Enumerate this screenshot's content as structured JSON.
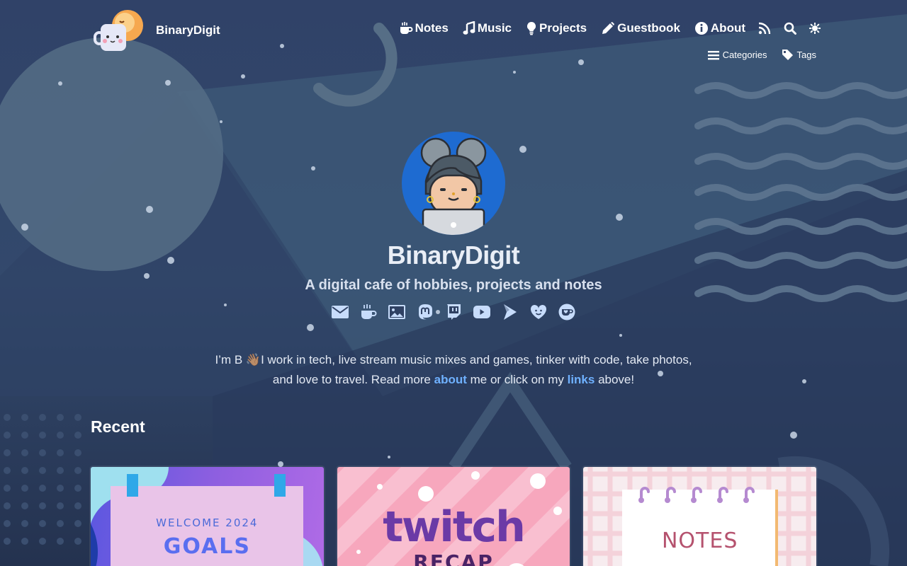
{
  "brand": {
    "name": "BinaryDigit"
  },
  "nav": {
    "items": [
      {
        "label": "Notes",
        "icon": "coffee-icon"
      },
      {
        "label": "Music",
        "icon": "music-icon"
      },
      {
        "label": "Projects",
        "icon": "lightbulb-icon"
      },
      {
        "label": "Guestbook",
        "icon": "pencil-icon"
      },
      {
        "label": "About",
        "icon": "info-icon"
      }
    ],
    "icon_buttons": [
      "rss-icon",
      "search-icon",
      "theme-toggle-icon"
    ],
    "sub_items": [
      {
        "label": "Categories",
        "icon": "list-icon"
      },
      {
        "label": "Tags",
        "icon": "tag-icon"
      }
    ]
  },
  "hero": {
    "title": "BinaryDigit",
    "tagline": "A digital cafe of hobbies, projects and notes",
    "socials": [
      "email-icon",
      "coffee-icon",
      "photo-icon",
      "mastodon-icon",
      "twitch-icon",
      "youtube-icon",
      "play-icon",
      "heart-smile-icon",
      "kofi-icon"
    ],
    "intro_line1": "I’m B 👋🏽I work in tech, live stream music mixes and games, tinker with code, take photos,",
    "intro_line2_pre": "and love to travel. Read more ",
    "intro_link_about": "about",
    "intro_line2_mid": " me or click on my ",
    "intro_link_links": "links",
    "intro_line2_post": " above!"
  },
  "recent": {
    "title": "Recent",
    "cards": [
      {
        "line1": "WELCOME 2024",
        "line2": "GOALS"
      },
      {
        "line1": "twitch",
        "line2": "RECAP"
      },
      {
        "line1": "NOTES"
      }
    ]
  },
  "colors": {
    "background": "#2f4163",
    "link": "#6fb1ff",
    "avatar_bg": "#1e6bd1"
  }
}
